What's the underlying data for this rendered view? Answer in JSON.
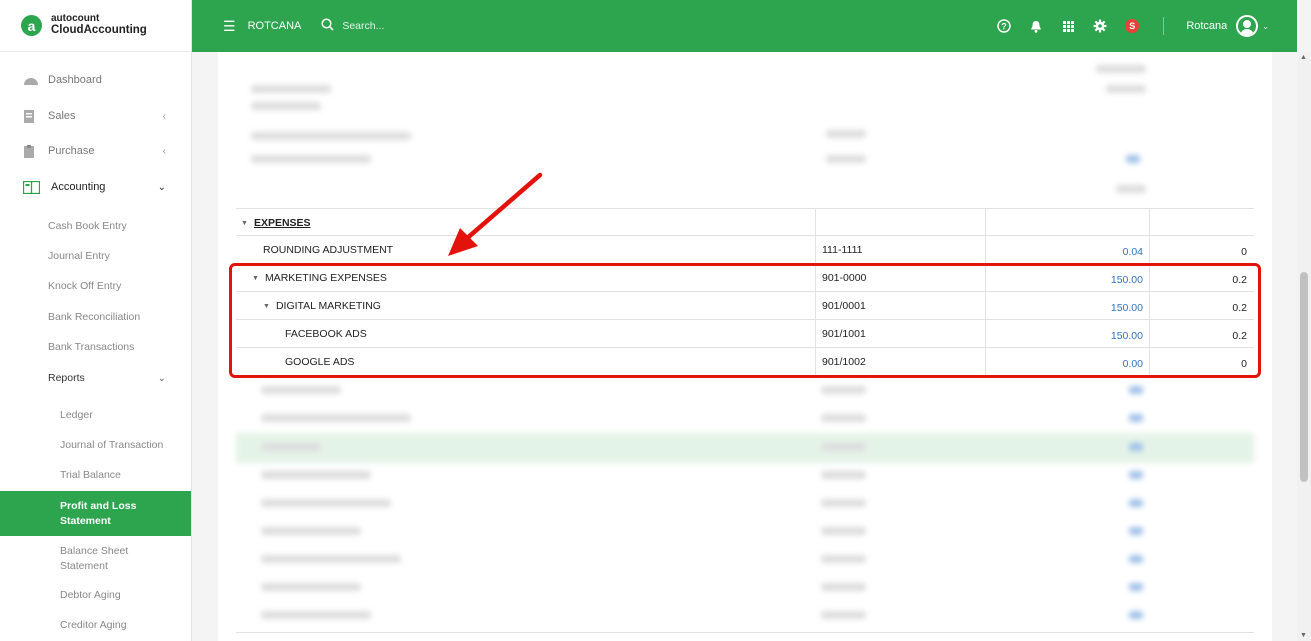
{
  "app": {
    "logo_text_top": "autocount",
    "logo_text_bottom": "CloudAccounting",
    "logo_letter": "a"
  },
  "sidebar": {
    "items": [
      {
        "label": "Dashboard",
        "icon": "dashboard-icon"
      },
      {
        "label": "Sales",
        "icon": "sales-icon",
        "chevron": "‹"
      },
      {
        "label": "Purchase",
        "icon": "purchase-icon",
        "chevron": "‹"
      },
      {
        "label": "Accounting",
        "icon": "accounting-icon",
        "chevron": "⌄"
      }
    ],
    "accounting_items": [
      "Cash Book Entry",
      "Journal Entry",
      "Knock Off Entry",
      "Bank Reconciliation",
      "Bank Transactions"
    ],
    "reports_label": "Reports",
    "reports_chevron": "⌄",
    "report_items": [
      "Ledger",
      "Journal of Transaction",
      "Trial Balance",
      "Profit and Loss Statement",
      "Balance Sheet Statement",
      "Debtor Aging",
      "Creditor Aging"
    ]
  },
  "header": {
    "company": "ROTCANA",
    "search_placeholder": "Search...",
    "notification_badge": "S",
    "user_name": "Rotcana",
    "accent_color": "#2da44e"
  },
  "table": {
    "section_label": "EXPENSES",
    "rows": [
      {
        "name": "ROUNDING ADJUSTMENT",
        "code": "111-1111",
        "amount": "0.04",
        "percent": "0"
      },
      {
        "name": "MARKETING EXPENSES",
        "code": "901-0000",
        "amount": "150.00",
        "percent": "0.2"
      },
      {
        "name": "DIGITAL MARKETING",
        "code": "901/0001",
        "amount": "150.00",
        "percent": "0.2"
      },
      {
        "name": "FACEBOOK ADS",
        "code": "901/1001",
        "amount": "150.00",
        "percent": "0.2"
      },
      {
        "name": "GOOGLE ADS",
        "code": "901/1002",
        "amount": "0.00",
        "percent": "0"
      }
    ],
    "highlight_color": "#e3120b"
  }
}
